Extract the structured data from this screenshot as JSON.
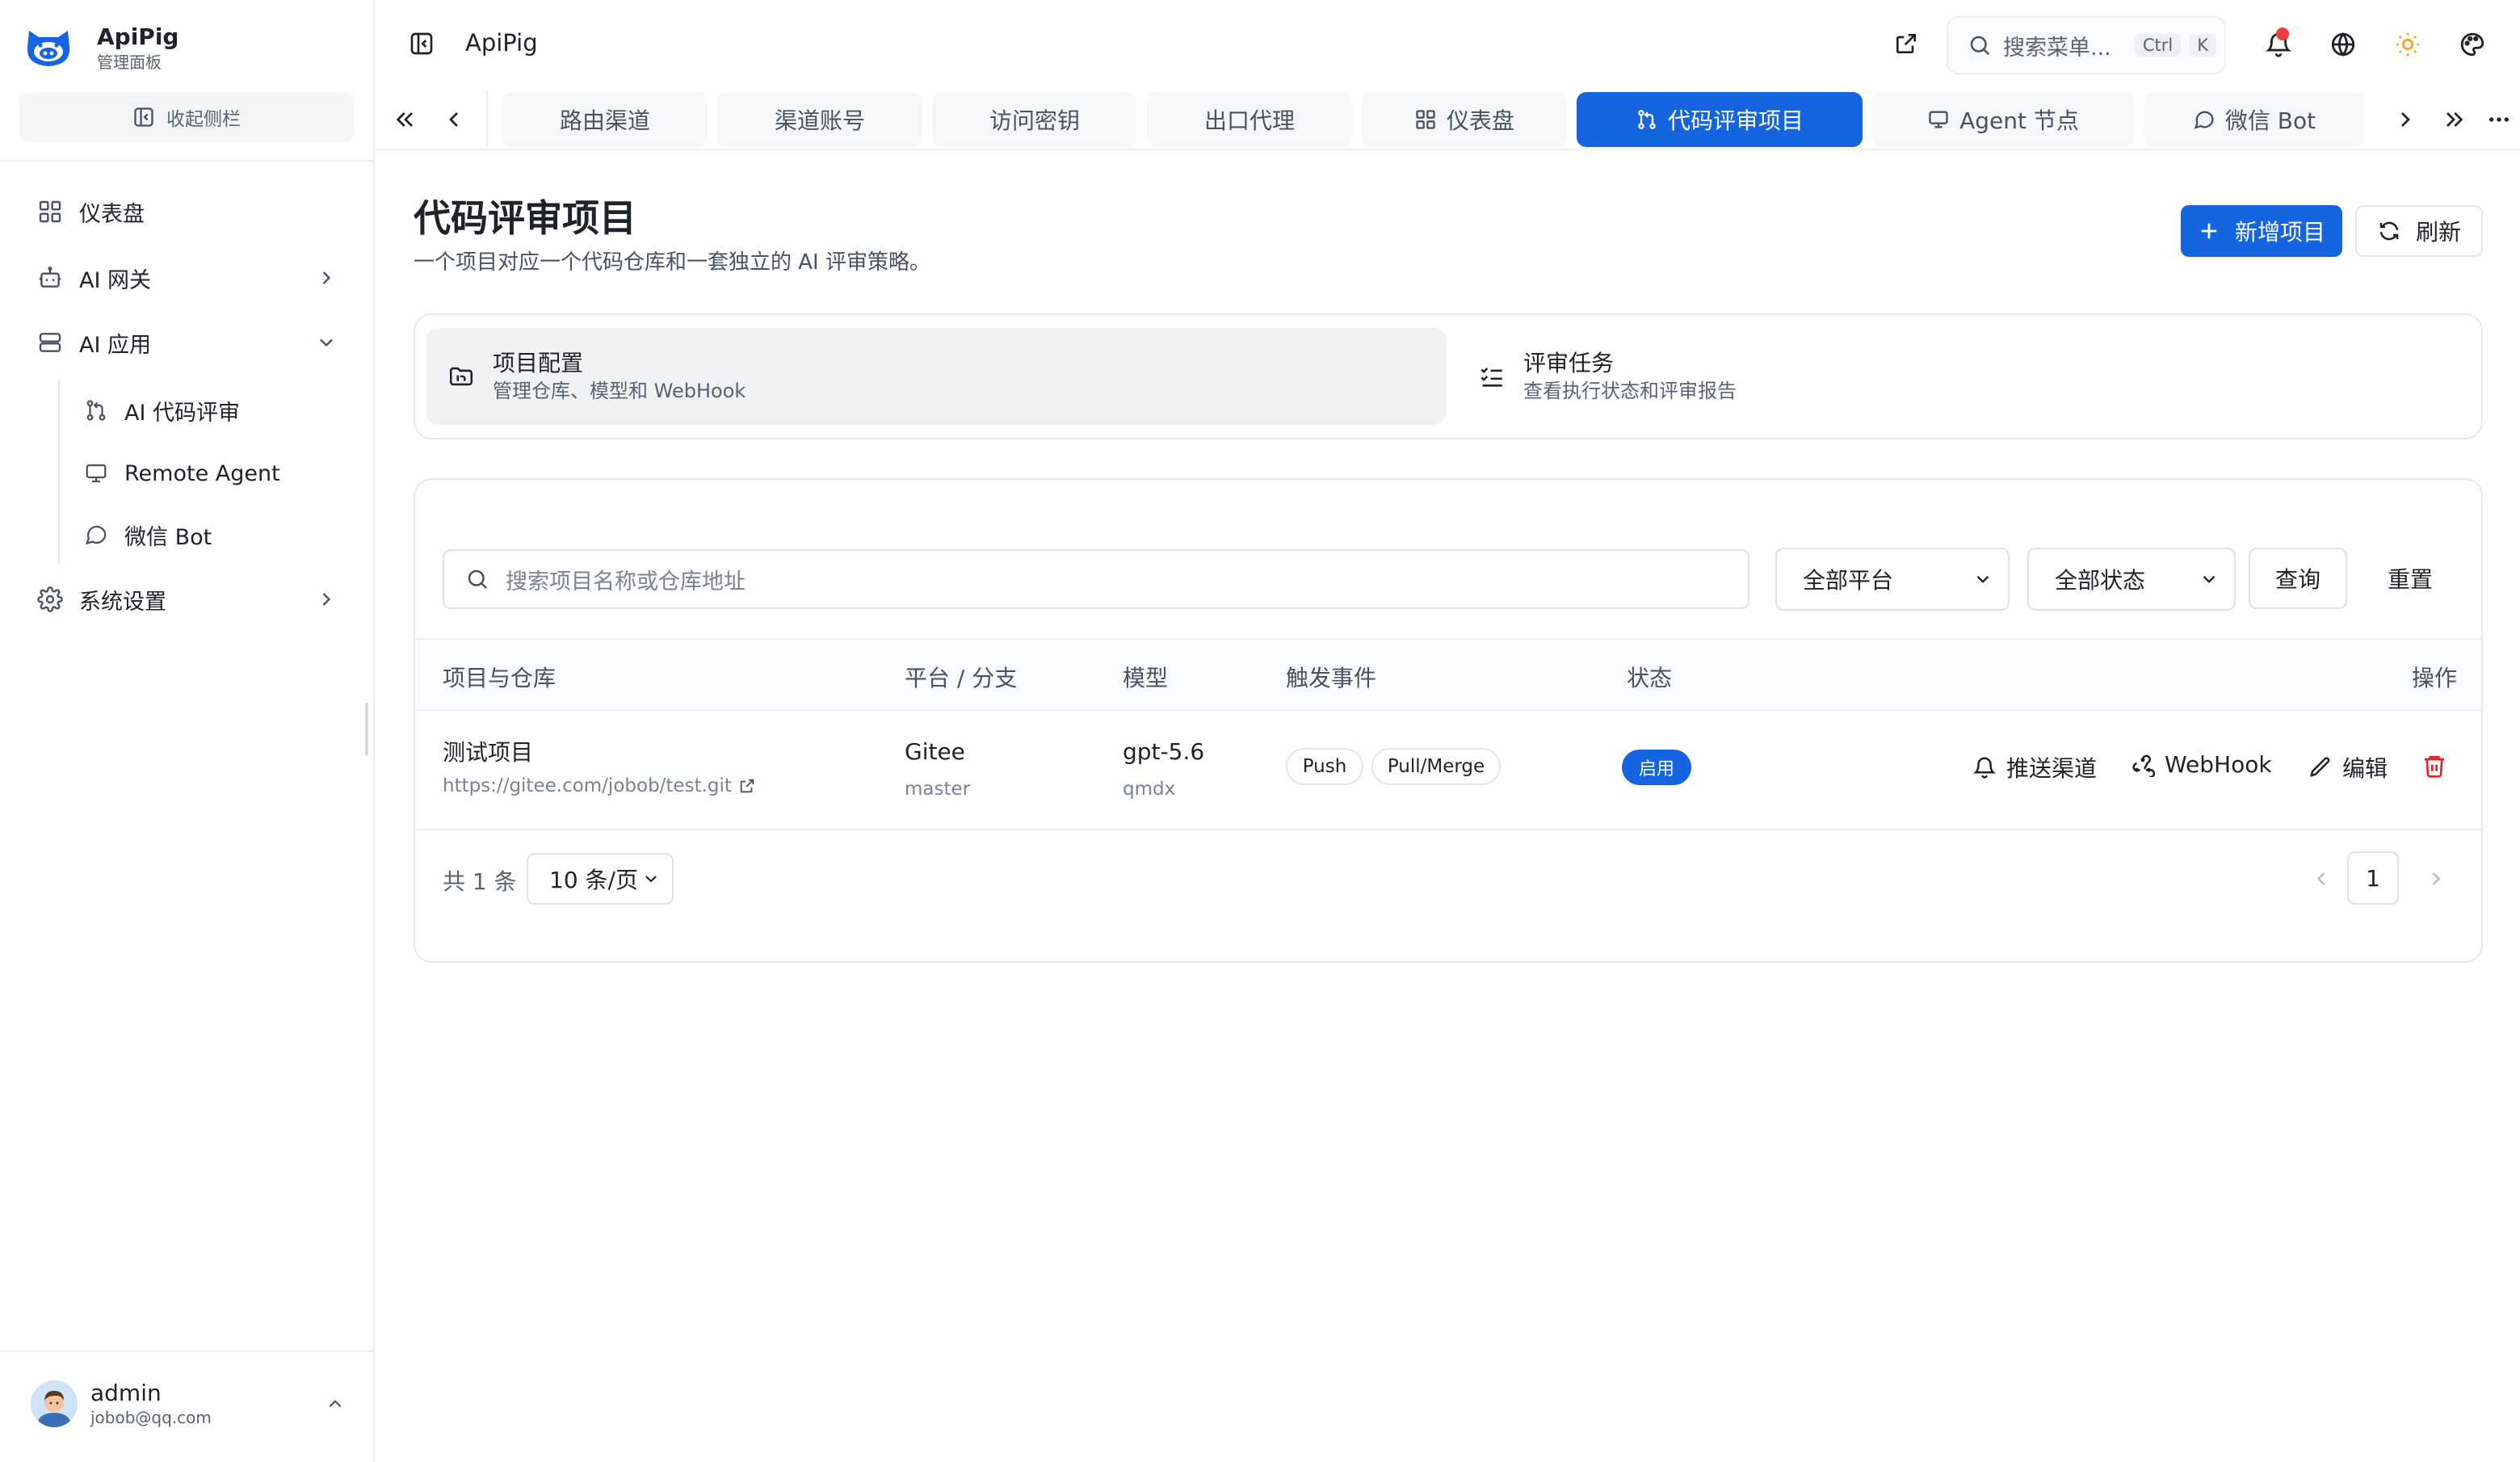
{
  "brand": {
    "name": "ApiPig",
    "subtitle": "管理面板"
  },
  "sidebar": {
    "collapse_label": "收起侧栏",
    "items": [
      {
        "label": "仪表盘",
        "icon": "dashboard-icon"
      },
      {
        "label": "AI 网关",
        "icon": "bot-icon"
      },
      {
        "label": "AI 应用",
        "icon": "server-icon"
      },
      {
        "label": "系统设置",
        "icon": "gear-icon"
      }
    ],
    "subitems": [
      {
        "label": "AI 代码评审",
        "icon": "git-pull-request-icon"
      },
      {
        "label": "Remote Agent",
        "icon": "monitor-icon"
      },
      {
        "label": "微信 Bot",
        "icon": "chat-bubble-icon"
      }
    ],
    "user": {
      "name": "admin",
      "email": "jobob@qq.com"
    }
  },
  "header": {
    "title": "ApiPig",
    "search_placeholder": "搜索菜单...",
    "kbd_ctrl": "Ctrl",
    "kbd_k": "K"
  },
  "tabs": [
    {
      "label": "路由渠道"
    },
    {
      "label": "渠道账号"
    },
    {
      "label": "访问密钥"
    },
    {
      "label": "出口代理"
    },
    {
      "label": "仪表盘",
      "icon": "dashboard-icon"
    },
    {
      "label": "代码评审项目",
      "icon": "git-pull-request-icon",
      "active": true
    },
    {
      "label": "Agent 节点",
      "icon": "monitor-icon"
    },
    {
      "label": "微信 Bot",
      "icon": "chat-bubble-icon"
    }
  ],
  "page": {
    "title": "代码评审项目",
    "subtitle": "一个项目对应一个代码仓库和一套独立的 AI 评审策略。",
    "add_button": "新增项目",
    "refresh_button": "刷新"
  },
  "segments": [
    {
      "title": "项目配置",
      "desc": "管理仓库、模型和 WebHook",
      "active": true
    },
    {
      "title": "评审任务",
      "desc": "查看执行状态和评审报告",
      "active": false
    }
  ],
  "filters": {
    "search_placeholder": "搜索项目名称或仓库地址",
    "platform_value": "全部平台",
    "status_value": "全部状态",
    "query_label": "查询",
    "reset_label": "重置"
  },
  "table": {
    "columns": [
      "项目与仓库",
      "平台 / 分支",
      "模型",
      "触发事件",
      "状态",
      "操作"
    ],
    "rows": [
      {
        "name": "测试项目",
        "repo": "https://gitee.com/jobob/test.git",
        "platform": "Gitee",
        "branch": "master",
        "model": "gpt-5.6",
        "model_sub": "qmdx",
        "events": [
          "Push",
          "Pull/Merge"
        ],
        "status": "启用",
        "actions": [
          "推送渠道",
          "WebHook",
          "编辑"
        ]
      }
    ]
  },
  "pagination": {
    "total_label": "共 1 条",
    "page_size": "10 条/页",
    "current_page": "1"
  },
  "colors": {
    "accent": "#1565e0",
    "danger": "#e02424",
    "notify": "#ef3b3b",
    "sun": "#f5a623"
  }
}
